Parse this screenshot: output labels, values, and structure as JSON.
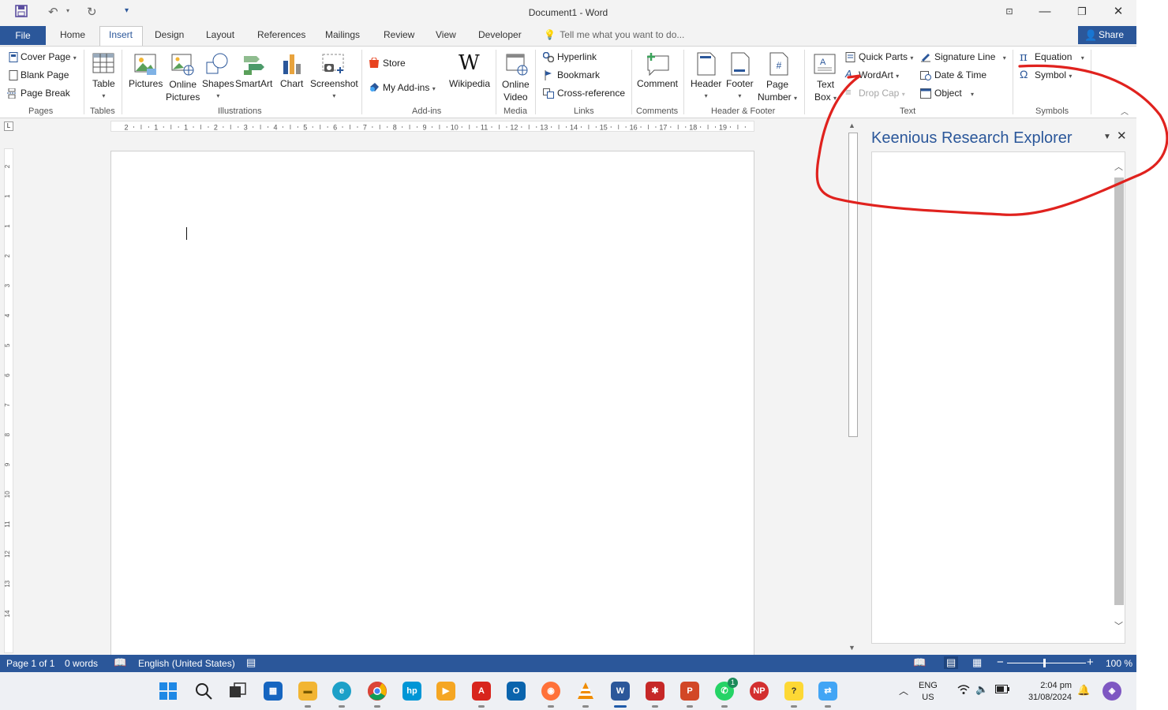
{
  "window": {
    "title": "Document1 - Word"
  },
  "tabs": {
    "file": "File",
    "home": "Home",
    "insert": "Insert",
    "design": "Design",
    "layout": "Layout",
    "references": "References",
    "mailings": "Mailings",
    "review": "Review",
    "view": "View",
    "developer": "Developer",
    "tell_me": "Tell me what you want to do...",
    "share": "Share"
  },
  "ribbon": {
    "pages": {
      "cover_page": "Cover Page",
      "blank_page": "Blank Page",
      "page_break": "Page Break",
      "group": "Pages"
    },
    "tables": {
      "table": "Table",
      "group": "Tables"
    },
    "illustrations": {
      "pictures": "Pictures",
      "online_pictures_1": "Online",
      "online_pictures_2": "Pictures",
      "shapes": "Shapes",
      "smartart": "SmartArt",
      "chart": "Chart",
      "screenshot": "Screenshot",
      "group": "Illustrations"
    },
    "addins": {
      "store": "Store",
      "my_addins": "My Add-ins",
      "wikipedia": "Wikipedia",
      "group": "Add-ins"
    },
    "media": {
      "online_video_1": "Online",
      "online_video_2": "Video",
      "group": "Media"
    },
    "links": {
      "hyperlink": "Hyperlink",
      "bookmark": "Bookmark",
      "cross_reference": "Cross-reference",
      "group": "Links"
    },
    "comments": {
      "comment": "Comment",
      "group": "Comments"
    },
    "header_footer": {
      "header": "Header",
      "footer": "Footer",
      "page_number_1": "Page",
      "page_number_2": "Number",
      "group": "Header & Footer"
    },
    "text": {
      "text_box_1": "Text",
      "text_box_2": "Box",
      "quick_parts": "Quick Parts",
      "wordart": "WordArt",
      "drop_cap": "Drop Cap",
      "signature_line": "Signature Line",
      "date_time": "Date & Time",
      "object": "Object",
      "group": "Text"
    },
    "symbols": {
      "equation": "Equation",
      "symbol": "Symbol",
      "group": "Symbols"
    }
  },
  "ruler": {
    "horizontal": [
      "2",
      "1",
      "1",
      "2",
      "3",
      "4",
      "5",
      "6",
      "7",
      "8",
      "9",
      "10",
      "11",
      "12",
      "13",
      "14",
      "15",
      "16",
      "17",
      "18",
      "19"
    ],
    "vertical": [
      "2",
      "1",
      "1",
      "2",
      "3",
      "4",
      "5",
      "6",
      "7",
      "8",
      "9",
      "10",
      "11",
      "12",
      "13",
      "14"
    ]
  },
  "task_pane": {
    "title": "Keenious Research Explorer"
  },
  "status": {
    "page": "Page 1 of 1",
    "words": "0 words",
    "language": "English (United States)",
    "zoom": "100 %"
  },
  "tray": {
    "lang_1": "ENG",
    "lang_2": "US",
    "time": "2:04 pm",
    "date": "31/08/2024",
    "whatsapp_badge": "1"
  },
  "colors": {
    "accent": "#2b579a",
    "annotation": "#e0221e"
  }
}
